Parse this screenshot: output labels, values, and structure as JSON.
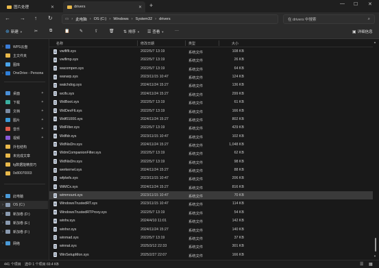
{
  "tabs": [
    {
      "label": "图片处理",
      "active": false
    },
    {
      "label": "drivers",
      "active": true
    }
  ],
  "addressbar": {
    "breadcrumbs": [
      "此电脑",
      "OS (C:)",
      "Windows",
      "System32",
      "drivers"
    ],
    "search_placeholder": "在 drivers 中搜索"
  },
  "toolbar": {
    "new_label": "新建",
    "sort_label": "排序",
    "view_label": "查看",
    "details_label": "详细信息"
  },
  "sidebar": {
    "items": [
      {
        "label": "WPS云盘",
        "icon": "cloud-icon",
        "color": "#3a7bd5"
      },
      {
        "label": "主文件夹",
        "icon": "home-icon",
        "color": "#e8b84a"
      },
      {
        "label": "图库",
        "icon": "gallery-icon",
        "color": "#4aa3e8"
      },
      {
        "label": "OneDrive - Persona",
        "icon": "onedrive-icon",
        "color": "#2f7fd8"
      },
      {
        "label": "桌面",
        "icon": "desktop-icon",
        "color": "#4a8fd8"
      },
      {
        "label": "下载",
        "icon": "download-icon",
        "color": "#3ab0a0"
      },
      {
        "label": "文档",
        "icon": "documents-icon",
        "color": "#7a8aa0"
      },
      {
        "label": "图片",
        "icon": "pictures-icon",
        "color": "#3a9ad8"
      },
      {
        "label": "音乐",
        "icon": "music-icon",
        "color": "#e05a4a"
      },
      {
        "label": "视频",
        "icon": "videos-icon",
        "color": "#8a5ad8"
      },
      {
        "label": "外包结构",
        "icon": "folder-icon",
        "color": "#e8b84a"
      },
      {
        "label": "未完成文章",
        "icon": "folder-icon",
        "color": "#e8b84a"
      },
      {
        "label": "fg数据能精技巧",
        "icon": "folder-icon",
        "color": "#e8b84a"
      },
      {
        "label": "0x80070003",
        "icon": "folder-icon",
        "color": "#e8b84a"
      },
      {
        "label": "此电脑",
        "icon": "computer-icon",
        "color": "#4a9ad8"
      },
      {
        "label": "OS (C:)",
        "icon": "drive-icon",
        "color": "#8a9ab0"
      },
      {
        "label": "新加卷 (D:)",
        "icon": "drive-icon",
        "color": "#8a9ab0"
      },
      {
        "label": "新加卷 (E:)",
        "icon": "drive-icon",
        "color": "#8a9ab0"
      },
      {
        "label": "新加卷 (F:)",
        "icon": "drive-icon",
        "color": "#8a9ab0"
      },
      {
        "label": "网络",
        "icon": "network-icon",
        "color": "#4a9ad8"
      }
    ]
  },
  "columns": {
    "name": "名称",
    "date": "修改日期",
    "type": "类型",
    "size": "大小"
  },
  "files": [
    {
      "name": "vwififlt.sys",
      "date": "2022/5/7 13:19",
      "type": "系统文件",
      "size": "108 KB"
    },
    {
      "name": "vwifimp.sys",
      "date": "2022/5/7 13:19",
      "type": "系统文件",
      "size": "26 KB"
    },
    {
      "name": "wacompen.sys",
      "date": "2022/5/7 13:19",
      "type": "系统文件",
      "size": "64 KB"
    },
    {
      "name": "wanarp.sys",
      "date": "2023/11/15 10:47",
      "type": "系统文件",
      "size": "124 KB"
    },
    {
      "name": "watchdog.sys",
      "date": "2024/11/24 15:27",
      "type": "系统文件",
      "size": "136 KB"
    },
    {
      "name": "wcifs.sys",
      "date": "2024/11/24 15:27",
      "type": "系统文件",
      "size": "299 KB"
    },
    {
      "name": "WdBoot.sys",
      "date": "2022/5/7 13:19",
      "type": "系统文件",
      "size": "61 KB"
    },
    {
      "name": "WdDevFlt.sys",
      "date": "2022/5/7 13:19",
      "type": "系统文件",
      "size": "166 KB"
    },
    {
      "name": "Wdf01000.sys",
      "date": "2024/11/24 15:27",
      "type": "系统文件",
      "size": "802 KB"
    },
    {
      "name": "WdFilter.sys",
      "date": "2022/5/7 13:19",
      "type": "系统文件",
      "size": "429 KB"
    },
    {
      "name": "Wdfldr.sys",
      "date": "2023/11/15 10:47",
      "type": "系统文件",
      "size": "102 KB"
    },
    {
      "name": "WdNisDrv.sys",
      "date": "2024/11/24 15:27",
      "type": "系统文件",
      "size": "1,048 KB"
    },
    {
      "name": "WdmCompanionFilter.sys",
      "date": "2022/5/7 13:19",
      "type": "系统文件",
      "size": "62 KB"
    },
    {
      "name": "WdNisDrv.sys",
      "date": "2022/5/7 13:19",
      "type": "系统文件",
      "size": "98 KB"
    },
    {
      "name": "werkernel.sys",
      "date": "2024/11/24 15:27",
      "type": "系统文件",
      "size": "88 KB"
    },
    {
      "name": "wfplwfs.sys",
      "date": "2023/11/15 10:47",
      "type": "系统文件",
      "size": "206 KB"
    },
    {
      "name": "WiMCx.sys",
      "date": "2024/11/24 15:27",
      "type": "系统文件",
      "size": "816 KB"
    },
    {
      "name": "wimmount.sys",
      "date": "2023/11/15 10:47",
      "type": "系统文件",
      "size": "70 KB"
    },
    {
      "name": "WindowsTrustedRT.sys",
      "date": "2023/11/15 10:47",
      "type": "系统文件",
      "size": "114 KB"
    },
    {
      "name": "WindowsTrustedRTProxy.sys",
      "date": "2022/5/7 13:19",
      "type": "系统文件",
      "size": "54 KB"
    },
    {
      "name": "winhv.sys",
      "date": "2024/4/10 11:01",
      "type": "系统文件",
      "size": "142 KB"
    },
    {
      "name": "winhvr.sys",
      "date": "2024/11/24 15:27",
      "type": "系统文件",
      "size": "140 KB"
    },
    {
      "name": "winmad.sys",
      "date": "2022/5/7 13:19",
      "type": "系统文件",
      "size": "37 KB"
    },
    {
      "name": "winnat.sys",
      "date": "2025/3/12 22:33",
      "type": "系统文件",
      "size": "301 KB"
    },
    {
      "name": "WinSetupMon.sys",
      "date": "2025/2/27 22:07",
      "type": "系统文件",
      "size": "166 KB"
    }
  ],
  "selected_file": "wimmount.sys",
  "status": {
    "count": "441 个项目",
    "selection": "选中 1 个项目  69.4 KB"
  }
}
